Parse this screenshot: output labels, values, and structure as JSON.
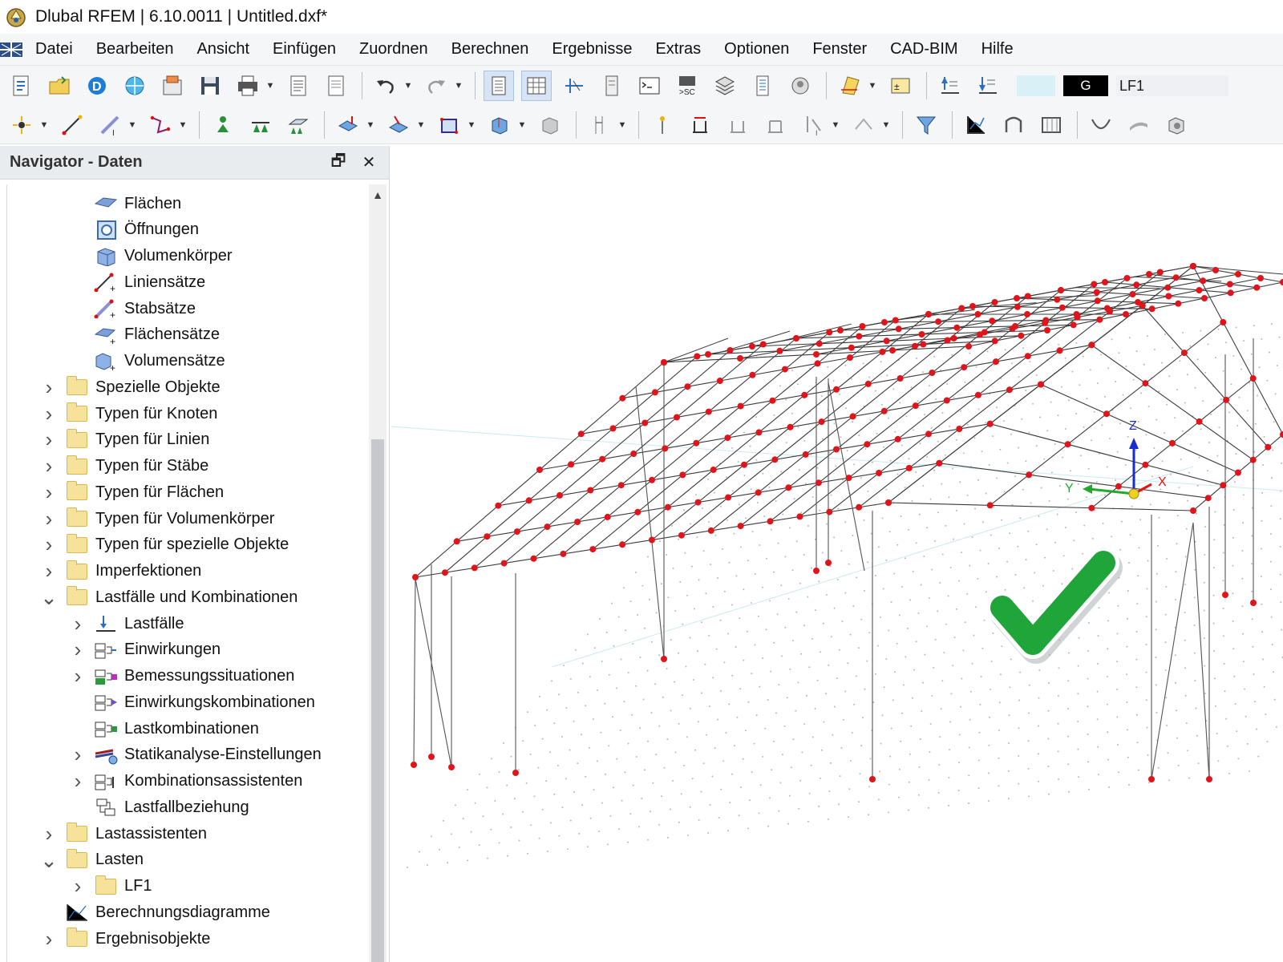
{
  "window": {
    "title": "Dlubal RFEM | 6.10.0011 | Untitled.dxf*",
    "app_icon": "rfem-logo-icon"
  },
  "menu": {
    "items": [
      "Datei",
      "Bearbeiten",
      "Ansicht",
      "Einfügen",
      "Zuordnen",
      "Berechnen",
      "Ergebnisse",
      "Extras",
      "Optionen",
      "Fenster",
      "CAD-BIM",
      "Hilfe"
    ]
  },
  "toolbar": {
    "load_case_type": "G",
    "load_case_name": "LF1",
    "load_case_color": "#d9f0f7"
  },
  "navigator": {
    "title": "Navigator - Daten",
    "tree": [
      {
        "label": "Flächen",
        "icon": "surface-icon",
        "level": 2,
        "expander": ""
      },
      {
        "label": "Öffnungen",
        "icon": "opening-icon",
        "level": 2,
        "expander": ""
      },
      {
        "label": "Volumenkörper",
        "icon": "solid-icon",
        "level": 2,
        "expander": ""
      },
      {
        "label": "Liniensätze",
        "icon": "line-set-icon",
        "level": 2,
        "expander": ""
      },
      {
        "label": "Stabsätze",
        "icon": "member-set-icon",
        "level": 2,
        "expander": ""
      },
      {
        "label": "Flächensätze",
        "icon": "surface-set-icon",
        "level": 2,
        "expander": ""
      },
      {
        "label": "Volumensätze",
        "icon": "solid-set-icon",
        "level": 2,
        "expander": ""
      },
      {
        "label": "Spezielle Objekte",
        "icon": "folder-icon",
        "level": 1,
        "expander": "collapsed"
      },
      {
        "label": "Typen für Knoten",
        "icon": "folder-icon",
        "level": 1,
        "expander": "collapsed"
      },
      {
        "label": "Typen für Linien",
        "icon": "folder-icon",
        "level": 1,
        "expander": "collapsed"
      },
      {
        "label": "Typen für Stäbe",
        "icon": "folder-icon",
        "level": 1,
        "expander": "collapsed"
      },
      {
        "label": "Typen für Flächen",
        "icon": "folder-icon",
        "level": 1,
        "expander": "collapsed"
      },
      {
        "label": "Typen für Volumenkörper",
        "icon": "folder-icon",
        "level": 1,
        "expander": "collapsed"
      },
      {
        "label": "Typen für spezielle Objekte",
        "icon": "folder-icon",
        "level": 1,
        "expander": "collapsed"
      },
      {
        "label": "Imperfektionen",
        "icon": "folder-icon",
        "level": 1,
        "expander": "collapsed"
      },
      {
        "label": "Lastfälle und Kombinationen",
        "icon": "folder-icon",
        "level": 1,
        "expander": "expanded"
      },
      {
        "label": "Lastfälle",
        "icon": "load-case-icon",
        "level": 2,
        "expander": "collapsed"
      },
      {
        "label": "Einwirkungen",
        "icon": "action-icon",
        "level": 2,
        "expander": "collapsed"
      },
      {
        "label": "Bemessungssituationen",
        "icon": "design-situation-icon",
        "level": 2,
        "expander": "collapsed"
      },
      {
        "label": "Einwirkungskombinationen",
        "icon": "action-combination-icon",
        "level": 2,
        "expander": ""
      },
      {
        "label": "Lastkombinationen",
        "icon": "load-combination-icon",
        "level": 2,
        "expander": ""
      },
      {
        "label": "Statikanalyse-Einstellungen",
        "icon": "static-analysis-settings-icon",
        "level": 2,
        "expander": "collapsed"
      },
      {
        "label": "Kombinationsassistenten",
        "icon": "combination-wizard-icon",
        "level": 2,
        "expander": "collapsed"
      },
      {
        "label": "Lastfallbeziehung",
        "icon": "load-case-relationship-icon",
        "level": 2,
        "expander": ""
      },
      {
        "label": "Lastassistenten",
        "icon": "folder-icon",
        "level": 1,
        "expander": "collapsed"
      },
      {
        "label": "Lasten",
        "icon": "folder-icon",
        "level": 1,
        "expander": "expanded"
      },
      {
        "label": "LF1",
        "icon": "folder-icon",
        "level": 2,
        "expander": "collapsed"
      },
      {
        "label": "Berechnungsdiagramme",
        "icon": "calculation-diagram-icon",
        "level": 1,
        "expander": ""
      },
      {
        "label": "Ergebnisobjekte",
        "icon": "folder-icon",
        "level": 1,
        "expander": "collapsed"
      }
    ]
  },
  "viewport": {
    "axis_labels": {
      "x": "X",
      "y": "Y",
      "z": "Z"
    },
    "overlay_icon": "checkmark-icon",
    "node_color": "#e0151b",
    "member_color": "#3a3a3a",
    "check_color": "#1fa53a"
  }
}
